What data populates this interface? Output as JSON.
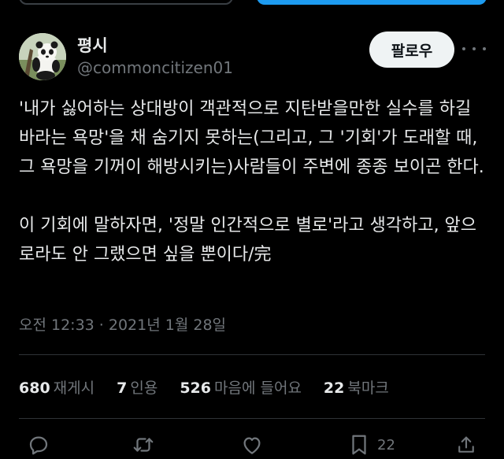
{
  "author": {
    "display_name": "평시",
    "handle": "@commoncitizen01",
    "avatar_icon": "panda-avatar-icon"
  },
  "follow_button": {
    "label": "팔로우"
  },
  "more_icon": "more-horizontal-icon",
  "tweet": {
    "paragraphs": [
      "'내가 싫어하는 상대방이 객관적으로 지탄받을만한 실수를 하길 바라는 욕망'을 채 숨기지 못하는(그리고, 그 '기회'가 도래할 때, 그 욕망을 기꺼이 해방시키는)사람들이 주변에 종종 보이곤 한다.",
      "이 기회에 말하자면, '정말 인간적으로 별로'라고 생각하고, 앞으로라도 안 그랬으면 싶을 뿐이다/完"
    ],
    "timestamp": "오전 12:33 · 2021년 1월 28일"
  },
  "stats": [
    {
      "value": "680",
      "label": "재게시"
    },
    {
      "value": "7",
      "label": "인용"
    },
    {
      "value": "526",
      "label": "마음에 들어요"
    },
    {
      "value": "22",
      "label": "북마크"
    }
  ],
  "actions": {
    "bookmark_count": "22",
    "icons": [
      "reply-icon",
      "retweet-icon",
      "like-icon",
      "bookmark-icon",
      "share-icon"
    ]
  },
  "colors": {
    "background": "#000000",
    "text_primary": "#e7e9ea",
    "text_secondary": "#71767b",
    "divider": "#2f3336",
    "follow_bg": "#eff3f4",
    "accent": "#1d9bf0"
  }
}
